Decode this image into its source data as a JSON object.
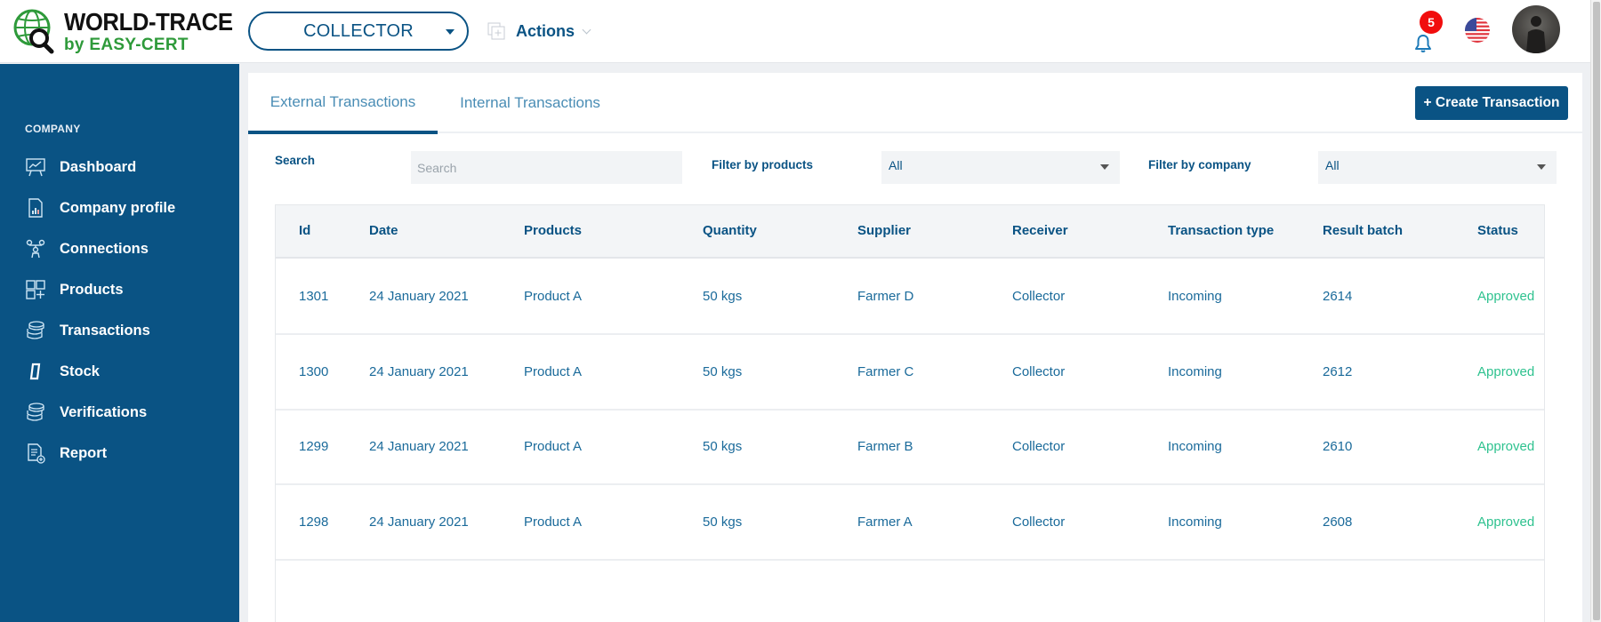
{
  "app": {
    "logo_title": "WORLD-TRACE",
    "logo_subtitle": "by EASY-CERT",
    "brand_color": "#0a5384",
    "logo_green": "#2e9a3a"
  },
  "topbar": {
    "role_select": {
      "selected": "COLLECTOR"
    },
    "actions_label": "Actions",
    "notifications_count": "5",
    "language": "en-US",
    "icons": {
      "actions": "add-layers-icon",
      "bell": "bell-icon",
      "flag": "us-flag-icon",
      "avatar": "user-avatar"
    }
  },
  "sidebar": {
    "section_label": "COMPANY",
    "items": [
      {
        "label": "Dashboard",
        "icon": "presentation-chart-icon"
      },
      {
        "label": "Company profile",
        "icon": "document-chart-icon"
      },
      {
        "label": "Connections",
        "icon": "network-people-icon"
      },
      {
        "label": "Products",
        "icon": "grid-add-icon"
      },
      {
        "label": "Transactions",
        "icon": "coin-stack-icon"
      },
      {
        "label": "Stock",
        "icon": "parallelogram-icon"
      },
      {
        "label": "Verifications",
        "icon": "coin-stack-icon"
      },
      {
        "label": "Report",
        "icon": "report-add-icon"
      }
    ]
  },
  "main": {
    "tabs": [
      {
        "label": "External Transactions",
        "active": true
      },
      {
        "label": "Internal Transactions",
        "active": false
      }
    ],
    "create_button": "+ Create Transaction",
    "filters": {
      "search_label": "Search",
      "search_placeholder": "Search",
      "search_value": "",
      "products_label": "Filter by products",
      "products_value": "All",
      "company_label": "Filter by company",
      "company_value": "All"
    },
    "table": {
      "columns": [
        "Id",
        "Date",
        "Products",
        "Quantity",
        "Supplier",
        "Receiver",
        "Transaction type",
        "Result batch",
        "Status"
      ],
      "rows": [
        [
          "1301",
          "24 January 2021",
          "Product A",
          "50 kgs",
          "Farmer D",
          "Collector",
          "Incoming",
          "2614",
          "Approved"
        ],
        [
          "1300",
          "24 January 2021",
          "Product A",
          "50 kgs",
          "Farmer C",
          "Collector",
          "Incoming",
          "2612",
          "Approved"
        ],
        [
          "1299",
          "24 January 2021",
          "Product A",
          "50 kgs",
          "Farmer B",
          "Collector",
          "Incoming",
          "2610",
          "Approved"
        ],
        [
          "1298",
          "24 January 2021",
          "Product A",
          "50 kgs",
          "Farmer A",
          "Collector",
          "Incoming",
          "2608",
          "Approved"
        ]
      ],
      "status_color": "#2ec28f"
    }
  }
}
